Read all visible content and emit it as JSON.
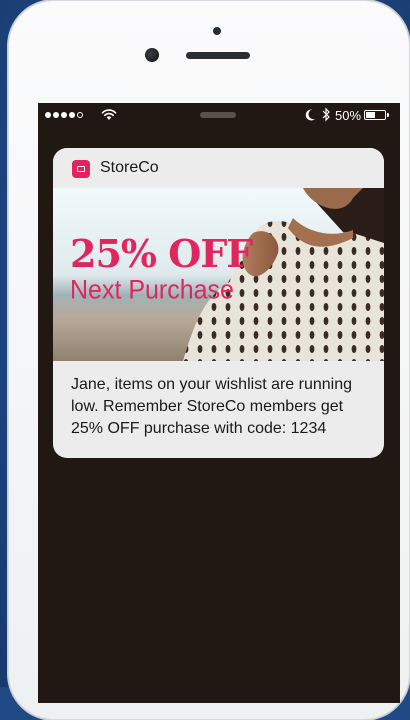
{
  "status_bar": {
    "signal_bars": 4,
    "signal_total": 5,
    "battery_percent_label": "50%",
    "battery_level": 0.5
  },
  "notification": {
    "app_name": "StoreCo",
    "app_icon": "store-icon",
    "banner": {
      "headline": "25% OFF",
      "subheadline": "Next Purchase"
    },
    "message": "Jane, items on your wishlist are running low. Remember StoreCo members get 25% OFF purchase with code: 1234"
  },
  "colors": {
    "accent": "#e1265f",
    "screen_bg": "#211814",
    "card_bg": "#ececec"
  }
}
